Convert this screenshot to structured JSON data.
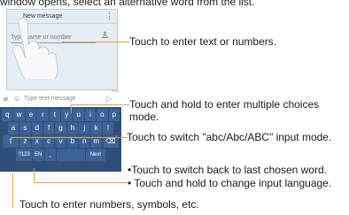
{
  "top_text": "window opens, select an alternative word from the list.",
  "phone": {
    "header_title": "New message",
    "to_placeholder": "Type name or number",
    "compose_placeholder": "Type text message",
    "counter": "160/1",
    "icons": [
      "menu-dots-icon",
      "add-contact-icon",
      "attach-icon",
      "emoji-icon",
      "send-icon",
      "hand-pointer-icon"
    ]
  },
  "keyboard": {
    "row1": [
      "q",
      "w",
      "e",
      "r",
      "t",
      "y",
      "u",
      "i",
      "o",
      "p"
    ],
    "row2": [
      "a",
      "s",
      "d",
      "f",
      "g",
      "h",
      "j",
      "k",
      "l"
    ],
    "row3": [
      "⇧",
      "z",
      "x",
      "c",
      "v",
      "b",
      "n",
      "m",
      "⌫"
    ],
    "row4": [
      "?123",
      "EN",
      ",",
      "",
      "Next"
    ]
  },
  "callouts": {
    "enter_text": "Touch to enter text or numbers.",
    "multi_choice_line1": "Touch and hold to enter multiple choices",
    "multi_choice_line2": "mode.",
    "switch_mode": "Touch to switch \"abc/Abc/ABC\" input mode.",
    "back_word": "•Touch to switch back to last chosen word.",
    "change_lang": "• Touch and hold to change input language.",
    "numbers_symbols": "Touch to enter numbers, symbols, etc."
  },
  "colors": {
    "keyboard": "#2f4f7a",
    "key": "#3d6295",
    "leader_line": "#e3a04a"
  }
}
